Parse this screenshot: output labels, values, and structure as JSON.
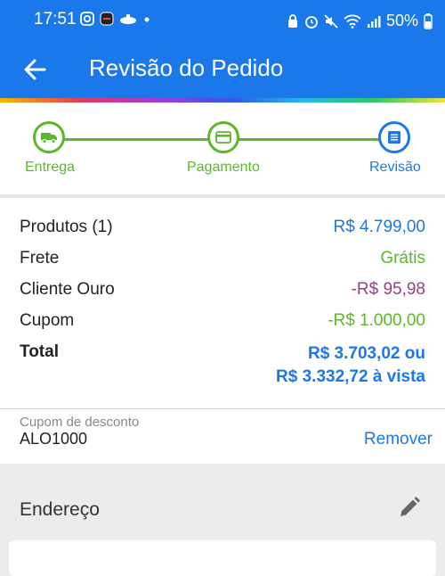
{
  "status_bar": {
    "time": "17:51",
    "battery": "50%"
  },
  "header": {
    "title": "Revisão do Pedido"
  },
  "stepper": {
    "steps": [
      {
        "label": "Entrega",
        "icon": "truck-icon",
        "state": "done"
      },
      {
        "label": "Pagamento",
        "icon": "card-icon",
        "state": "done"
      },
      {
        "label": "Revisão",
        "icon": "document-icon",
        "state": "active"
      }
    ]
  },
  "summary": {
    "rows": [
      {
        "label": "Produtos (1)",
        "value": "R$ 4.799,00",
        "color": "#1a78eb"
      },
      {
        "label": "Frete",
        "value": "Grátis",
        "color": "#5bb82a"
      },
      {
        "label": "Cliente Ouro",
        "value": "-R$ 95,98",
        "color": "#9b3c8c"
      },
      {
        "label": "Cupom",
        "value": "-R$ 1.000,00",
        "color": "#5bb82a"
      }
    ],
    "total": {
      "label": "Total",
      "line1": "R$ 3.703,02 ou",
      "line2": "R$ 3.332,72 à vista"
    }
  },
  "coupon": {
    "caption": "Cupom de desconto",
    "code": "ALO1000",
    "remove_label": "Remover"
  },
  "address": {
    "title": "Endereço"
  },
  "colors": {
    "primary": "#1a78eb",
    "success": "#5bb82a",
    "discount": "#9b3c8c"
  }
}
